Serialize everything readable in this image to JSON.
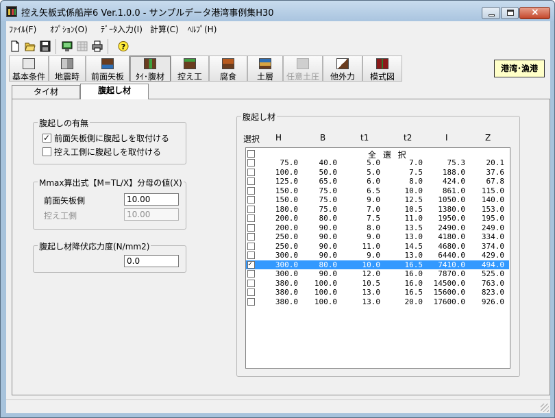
{
  "window": {
    "title": "控え矢板式係船岸6 Ver.1.0.0 - サンプルデータ港湾事例集H30"
  },
  "menu": [
    "ﾌｧｲﾙ(F)",
    "ｵﾌﾟｼｮﾝ(O)",
    "ﾃﾞｰﾀ入力(I)",
    "計算(C)",
    "ﾍﾙﾌﾟ(H)"
  ],
  "toolbar_icons": [
    "new-file-icon",
    "open-folder-icon",
    "save-icon",
    "monitor-icon",
    "table-icon",
    "print-icon",
    "help-icon"
  ],
  "nav_buttons": [
    {
      "label": "基本条件",
      "icon": "sheet-icon"
    },
    {
      "label": "地震時",
      "icon": "seismic-icon"
    },
    {
      "label": "前面矢板",
      "icon": "front-sheetpile-icon"
    },
    {
      "label": "ﾀｲ･腹材",
      "icon": "tie-wale-icon"
    },
    {
      "label": "控え工",
      "icon": "anchor-icon"
    },
    {
      "label": "腐食",
      "icon": "corrosion-icon"
    },
    {
      "label": "土層",
      "icon": "soil-layer-icon"
    },
    {
      "label": "任意土圧",
      "icon": "earth-pressure-icon"
    },
    {
      "label": "他外力",
      "icon": "external-force-icon"
    },
    {
      "label": "模式図",
      "icon": "diagram-icon"
    }
  ],
  "region_badge": "港湾･漁港",
  "tabs": [
    {
      "label": "タイ材",
      "active": false
    },
    {
      "label": "腹起し材",
      "active": true
    }
  ],
  "wale_presence": {
    "title": "腹起しの有無",
    "front_label": "前面矢板側に腹起しを取付ける",
    "front_checked": true,
    "anchor_label": "控え工側に腹起しを取付ける",
    "anchor_checked": false
  },
  "mmax": {
    "title": "Mmax算出式【M=TL/X】分母の値(X)",
    "front_label": "前面矢板側",
    "front_value": "10.00",
    "anchor_label": "控え工側",
    "anchor_value": "10.00"
  },
  "yield": {
    "title": "腹起し材降伏応力度(N/mm2)",
    "value": "0.0"
  },
  "wale_table": {
    "title": "腹起し材",
    "headers": [
      "選択",
      "H",
      "B",
      "t1",
      "t2",
      "I",
      "Z"
    ],
    "select_all": "全 選 択",
    "rows": [
      [
        "75.0",
        "40.0",
        "5.0",
        "7.0",
        "75.3",
        "20.1"
      ],
      [
        "100.0",
        "50.0",
        "5.0",
        "7.5",
        "188.0",
        "37.6"
      ],
      [
        "125.0",
        "65.0",
        "6.0",
        "8.0",
        "424.0",
        "67.8"
      ],
      [
        "150.0",
        "75.0",
        "6.5",
        "10.0",
        "861.0",
        "115.0"
      ],
      [
        "150.0",
        "75.0",
        "9.0",
        "12.5",
        "1050.0",
        "140.0"
      ],
      [
        "180.0",
        "75.0",
        "7.0",
        "10.5",
        "1380.0",
        "153.0"
      ],
      [
        "200.0",
        "80.0",
        "7.5",
        "11.0",
        "1950.0",
        "195.0"
      ],
      [
        "200.0",
        "90.0",
        "8.0",
        "13.5",
        "2490.0",
        "249.0"
      ],
      [
        "250.0",
        "90.0",
        "9.0",
        "13.0",
        "4180.0",
        "334.0"
      ],
      [
        "250.0",
        "90.0",
        "11.0",
        "14.5",
        "4680.0",
        "374.0"
      ],
      [
        "300.0",
        "90.0",
        "9.0",
        "13.0",
        "6440.0",
        "429.0"
      ],
      [
        "300.0",
        "80.0",
        "10.0",
        "16.5",
        "7410.0",
        "494.0"
      ],
      [
        "300.0",
        "90.0",
        "12.0",
        "16.0",
        "7870.0",
        "525.0"
      ],
      [
        "380.0",
        "100.0",
        "10.5",
        "16.0",
        "14500.0",
        "763.0"
      ],
      [
        "380.0",
        "100.0",
        "13.0",
        "16.5",
        "15600.0",
        "823.0"
      ],
      [
        "380.0",
        "100.0",
        "13.0",
        "20.0",
        "17600.0",
        "926.0"
      ]
    ],
    "checked_rows": [
      11
    ],
    "selected_row": 11
  },
  "colors": {
    "selection": "#3399ff",
    "region_badge_bg": "#ffffc8"
  }
}
